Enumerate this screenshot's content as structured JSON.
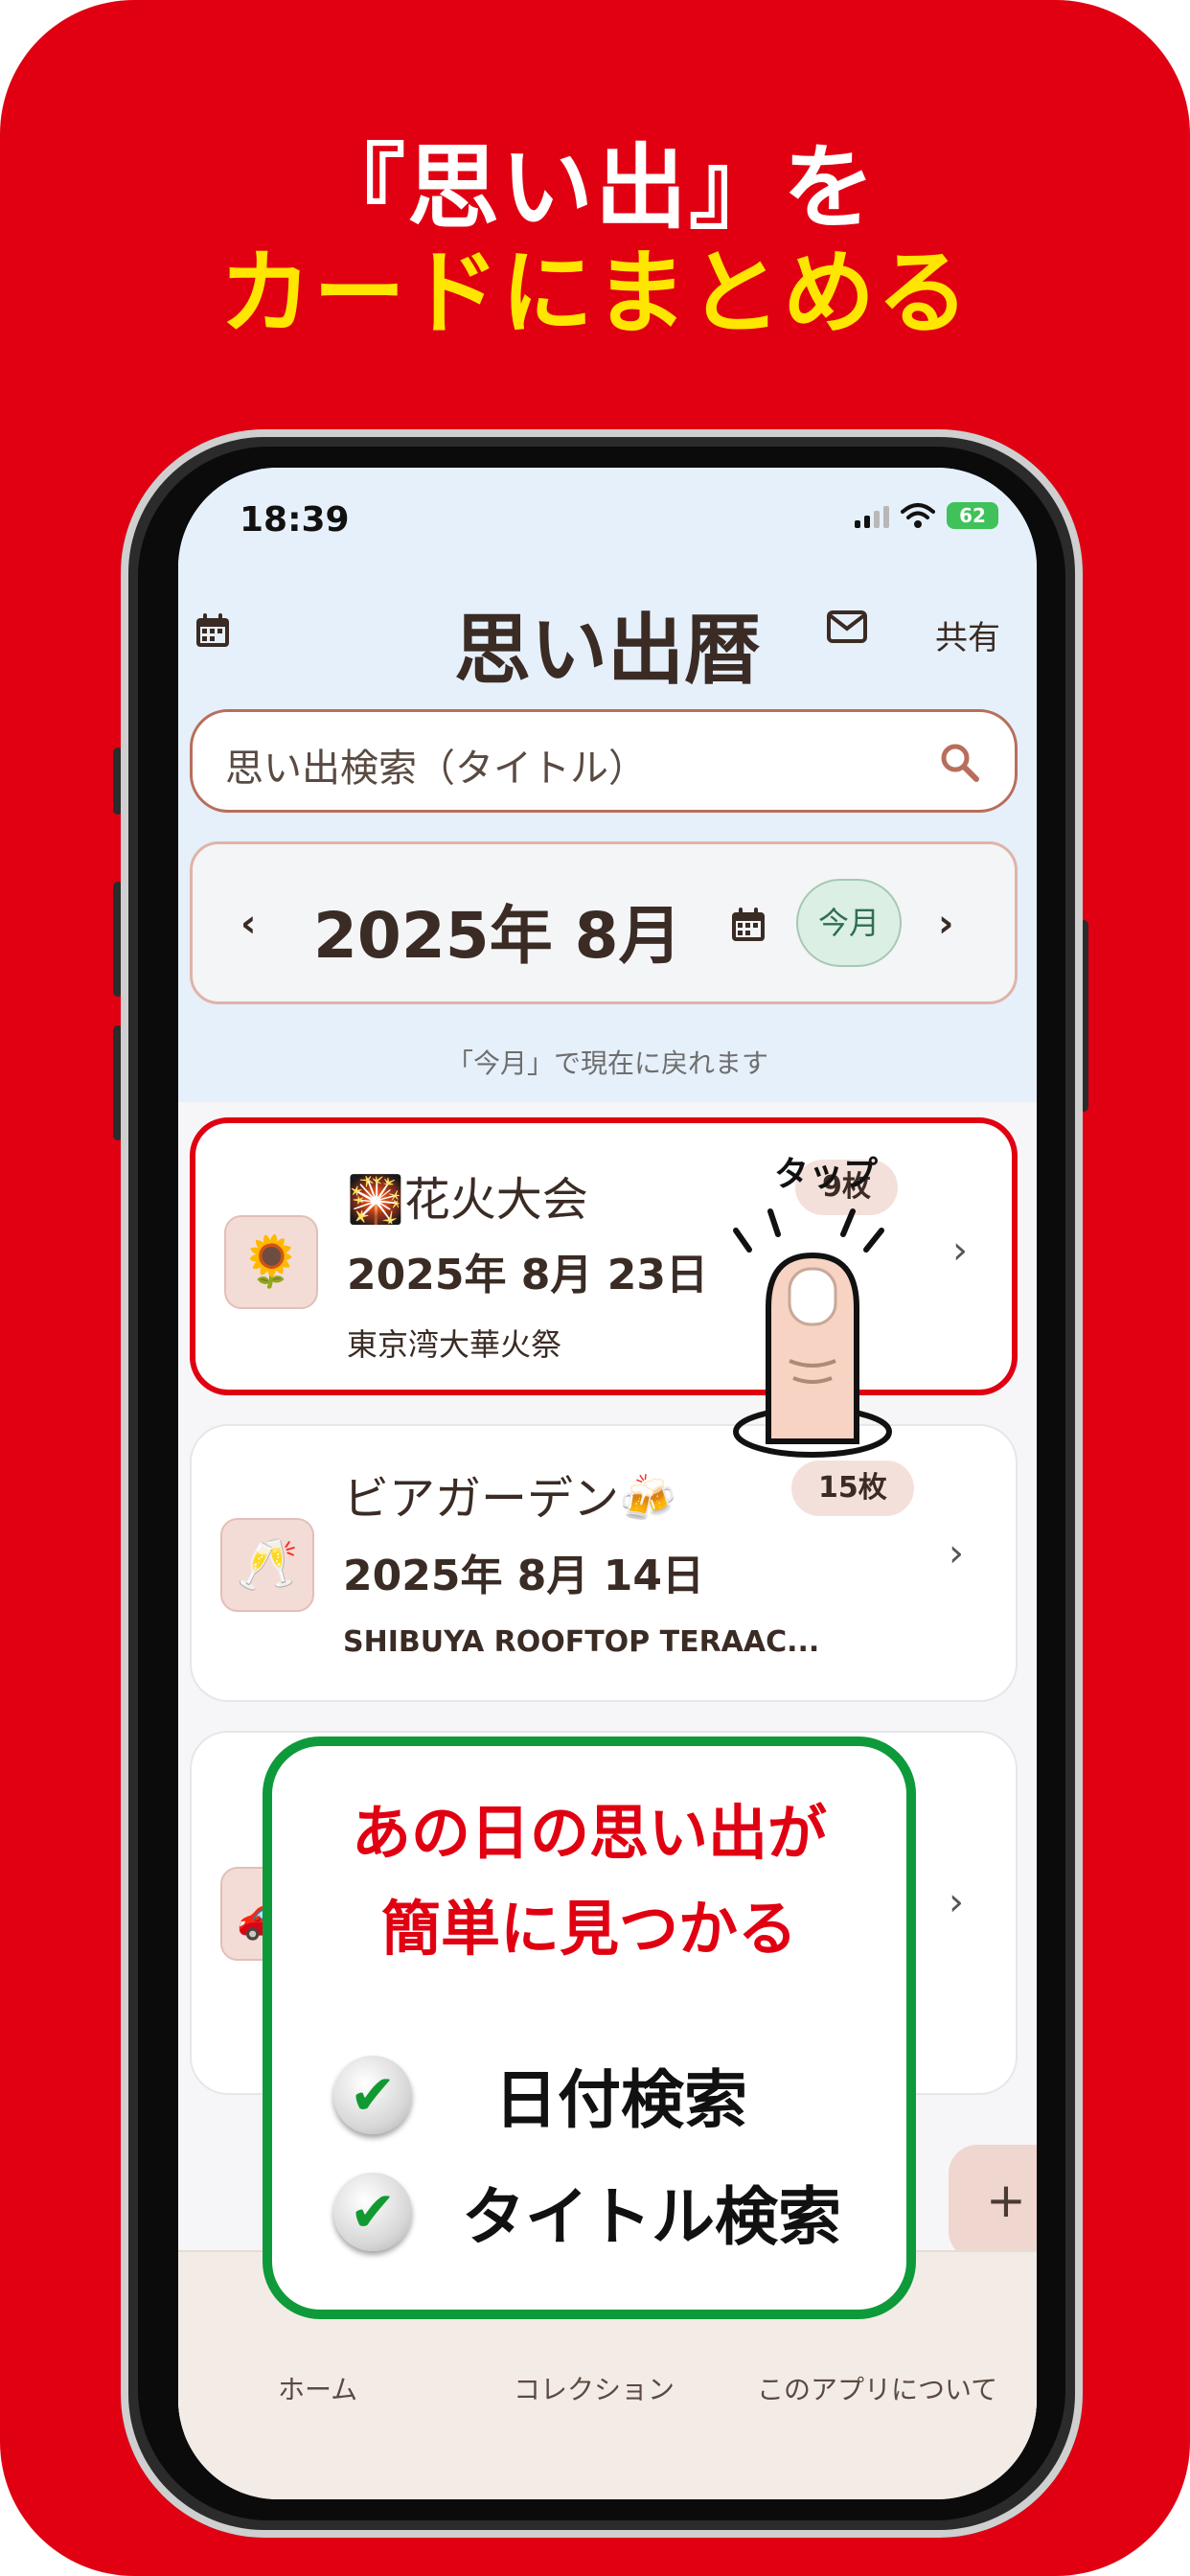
{
  "promo": {
    "headline_line1": "『思い出』を",
    "headline_line2": "カードにまとめる"
  },
  "status_bar": {
    "time": "18:39",
    "battery": "62"
  },
  "header": {
    "title": "思い出暦",
    "share_label": "共有"
  },
  "search": {
    "placeholder": "思い出検索（タイトル）"
  },
  "month_nav": {
    "prev": "‹",
    "current": "2025年 8月",
    "today_button": "今月",
    "next": "›",
    "hint": "「今月」で現在に戻れます"
  },
  "cards": [
    {
      "emoji": "🌻",
      "title": "🎇花火大会",
      "date": "2025年 8月 23日",
      "place": "東京湾大華火祭",
      "count": "9枚"
    },
    {
      "emoji": "🥂",
      "title": "ビアガーデン🍻",
      "date": "2025年 8月 14日",
      "place": "SHIBUYA ROOFTOP TERAAC...",
      "count": "15枚"
    },
    {
      "emoji": "🚗"
    }
  ],
  "tap_label": "タップ",
  "fab_label": "+",
  "tabs": [
    "ホーム",
    "コレクション",
    "このアプリについて"
  ],
  "overlay": {
    "line1": "あの日の思い出が",
    "line2": "簡単に見つかる",
    "item1": "日付検索",
    "item2": "タイトル検索",
    "check_icon": "✔"
  },
  "colors": {
    "brand_red": "#e00012",
    "accent_yellow": "#ffe600",
    "accent_green": "#0e9a3a"
  }
}
